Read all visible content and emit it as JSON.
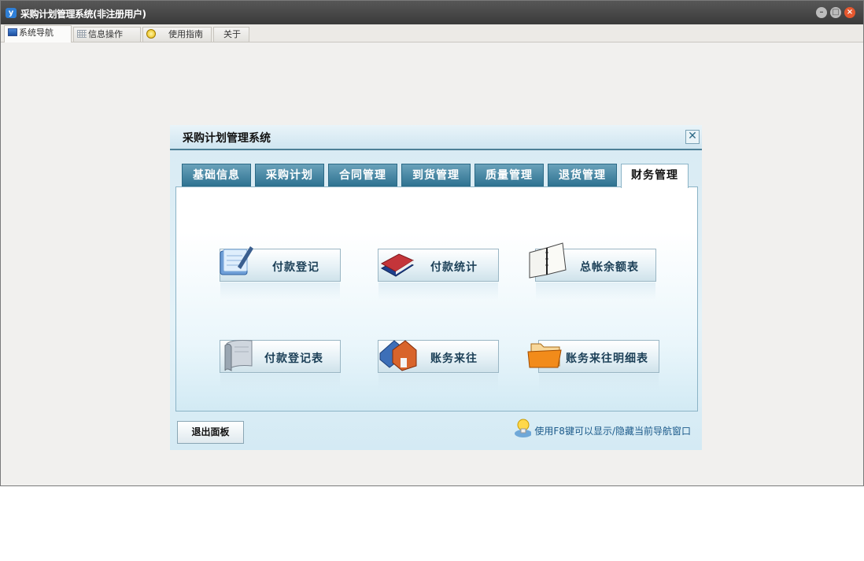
{
  "window": {
    "title": "采购计划管理系统(非注册用户)",
    "app_icon_letter": "y"
  },
  "top_tabs": [
    {
      "label": "系统导航",
      "icon": "monitor-icon",
      "active": true
    },
    {
      "label": "信息操作",
      "icon": "grid-icon",
      "active": false
    },
    {
      "label": "使用指南",
      "icon": "bulb-icon",
      "active": false
    },
    {
      "label": "关于",
      "icon": "",
      "active": false
    }
  ],
  "panel": {
    "title": "采购计划管理系统",
    "close_glyph": "✕",
    "tabs": [
      "基础信息",
      "采购计划",
      "合同管理",
      "到货管理",
      "质量管理",
      "退货管理",
      "财务管理"
    ],
    "active_tab": "财务管理",
    "buttons": [
      {
        "label": "付款登记",
        "icon": "notebook-pen-icon"
      },
      {
        "label": "付款统计",
        "icon": "books-icon"
      },
      {
        "label": "总帐余额表",
        "icon": "open-book-icon"
      },
      {
        "label": "付款登记表",
        "icon": "scroll-icon"
      },
      {
        "label": "账务来往",
        "icon": "house-icon"
      },
      {
        "label": "账务来往明细表",
        "icon": "folder-icon"
      }
    ],
    "exit_label": "退出面板",
    "hint": "使用F8键可以显示/隐藏当前导航窗口"
  },
  "colors": {
    "tab_blue": "#2f7392",
    "panel_bg": "#e4f2f8",
    "label_dark_blue": "#1b3f57",
    "close_red": "#e5582f"
  }
}
